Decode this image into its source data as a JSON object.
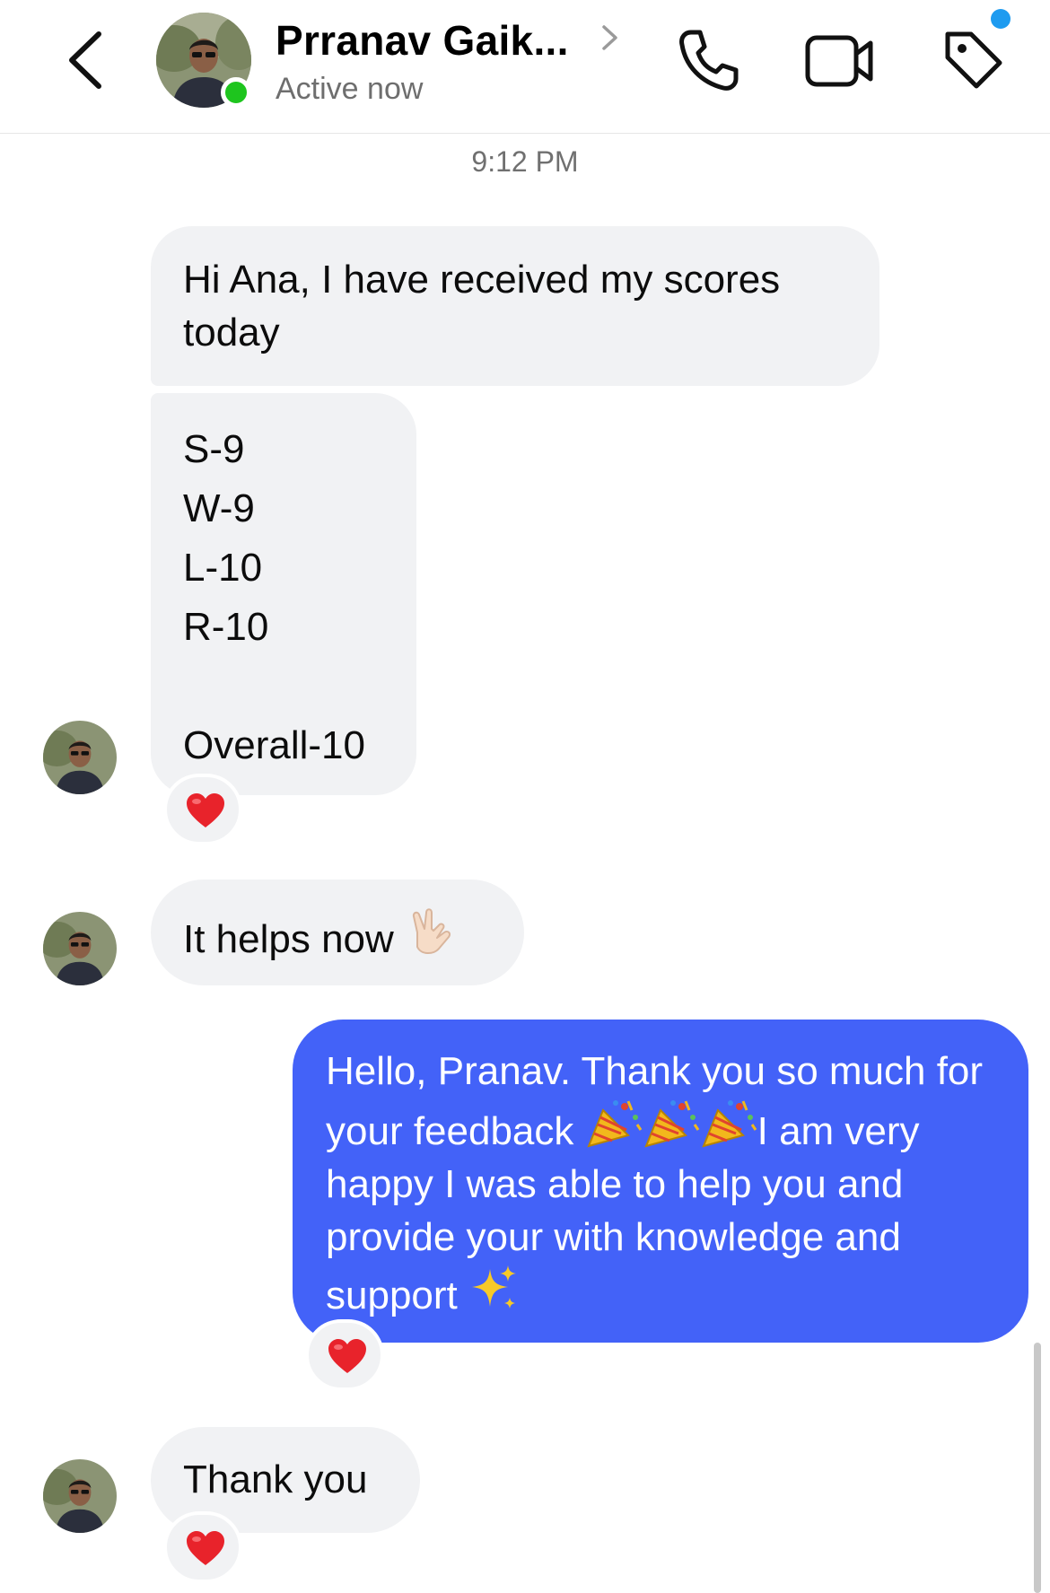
{
  "header": {
    "contact_name": "Prranav Gaik...",
    "status": "Active now",
    "icons": [
      "back-chevron-icon",
      "avatar",
      "online-indicator",
      "chevron-right-icon",
      "phone-icon",
      "video-camera-icon",
      "tag-icon"
    ],
    "online_color": "#1ec51e",
    "notification_color": "#1e9bf0"
  },
  "thread": {
    "timestamp": "9:12 PM",
    "messages": [
      {
        "from": "contact",
        "text": "Hi Ana, I have received my scores today"
      },
      {
        "from": "contact",
        "text": "S-9\nW-9\nL-10\nR-10\n\nOverall-10",
        "reaction": "❤️"
      },
      {
        "from": "contact",
        "text": "It helps now ",
        "emoji": "🤟"
      },
      {
        "from": "me",
        "text_parts": [
          "Hello, Pranav. Thank you so much for your feedback ",
          "I am very happy I was able to help you and provide your with knowledge and support "
        ],
        "emojis": [
          "🎉",
          "🎉",
          "🎉",
          "✨"
        ],
        "reaction": "❤️"
      },
      {
        "from": "contact",
        "text": "Thank you",
        "reaction": "❤️"
      }
    ]
  },
  "colors": {
    "incoming_bubble": "#f1f2f4",
    "outgoing_bubble": "#4362f8",
    "reaction_heart": "#e8232b"
  }
}
